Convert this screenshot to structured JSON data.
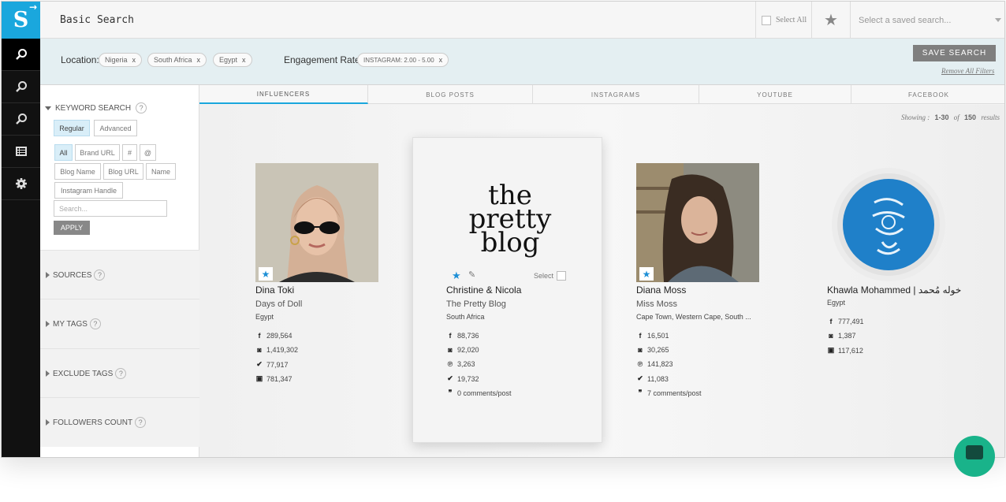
{
  "header": {
    "logo": "S",
    "title": "Basic Search",
    "select_all": "Select All",
    "saved_search_placeholder": "Select a saved search..."
  },
  "filters": {
    "location_label": "Location:",
    "locations": [
      "Nigeria",
      "South Africa",
      "Egypt"
    ],
    "engagement_label": "Engagement Rate:",
    "engagement_chip": "INSTAGRAM: 2.00 - 5.00",
    "remove_char": "x",
    "save_search": "SAVE SEARCH",
    "remove_all": "Remove All Filters"
  },
  "sidebar": {
    "keyword_search": "KEYWORD SEARCH",
    "help": "?",
    "mode": [
      "Regular",
      "Advanced"
    ],
    "fields_row1": [
      "All",
      "Brand URL",
      "#",
      "@"
    ],
    "fields_row2": [
      "Blog Name",
      "Blog URL",
      "Name"
    ],
    "fields_row3": [
      "Instagram Handle"
    ],
    "search_placeholder": "Search...",
    "apply": "APPLY",
    "sections": [
      "SOURCES",
      "MY TAGS",
      "EXCLUDE TAGS",
      "FOLLOWERS COUNT"
    ]
  },
  "tabs": [
    "INFLUENCERS",
    "BLOG POSTS",
    "INSTAGRAMS",
    "YOUTUBE",
    "FACEBOOK"
  ],
  "results": {
    "showing_label": "Showing :",
    "range": "1-30",
    "of": "of",
    "total": "150",
    "results_label": "results"
  },
  "cards": [
    {
      "name": "Dina Toki",
      "blog": "Days of Doll",
      "location": "Egypt",
      "stats": [
        {
          "icon": "facebook-icon",
          "value": "289,564"
        },
        {
          "icon": "instagram-icon",
          "value": "1,419,302"
        },
        {
          "icon": "twitter-icon",
          "value": "77,917"
        },
        {
          "icon": "youtube-icon",
          "value": "781,347"
        }
      ]
    },
    {
      "name": "Christine & Nicola",
      "blog": "The Pretty Blog",
      "location": "South Africa",
      "logo_lines": [
        "the",
        "pretty",
        "blog"
      ],
      "select_label": "Select",
      "stats": [
        {
          "icon": "facebook-icon",
          "value": "88,736"
        },
        {
          "icon": "instagram-icon",
          "value": "92,020"
        },
        {
          "icon": "pinterest-icon",
          "value": "3,263"
        },
        {
          "icon": "twitter-icon",
          "value": "19,732"
        },
        {
          "icon": "comments-icon",
          "value": "0 comments/post"
        }
      ]
    },
    {
      "name": "Diana Moss",
      "blog": "Miss Moss",
      "location": "Cape Town, Western Cape, South ...",
      "stats": [
        {
          "icon": "facebook-icon",
          "value": "16,501"
        },
        {
          "icon": "instagram-icon",
          "value": "30,265"
        },
        {
          "icon": "pinterest-icon",
          "value": "141,823"
        },
        {
          "icon": "twitter-icon",
          "value": "11,083"
        },
        {
          "icon": "comments-icon",
          "value": "7 comments/post"
        }
      ]
    },
    {
      "name": "Khawla Mohammed | خوله مُحمد",
      "location": "Egypt",
      "stats": [
        {
          "icon": "facebook-icon",
          "value": "777,491"
        },
        {
          "icon": "instagram-icon",
          "value": "1,387"
        },
        {
          "icon": "youtube-icon",
          "value": "117,612"
        }
      ]
    }
  ],
  "colors": {
    "brand": "#1aa7dd",
    "rail": "#111111",
    "filter_bar": "#e4eff2",
    "star": "#1d8fd6",
    "chat": "#19b38a"
  }
}
